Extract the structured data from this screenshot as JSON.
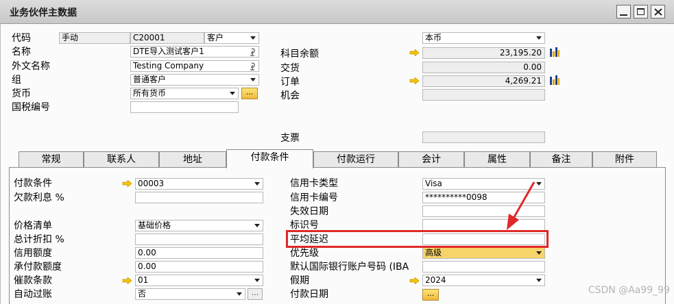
{
  "window": {
    "title": "业务伙伴主数据"
  },
  "header_left": {
    "code_label": "代码",
    "mode": "手动",
    "code_value": "C20001",
    "type_value": "客户",
    "name_label": "名称",
    "name_value": "DTE导入测试客户1",
    "foreign_name_label": "外文名称",
    "foreign_name_value": "Testing Company",
    "group_label": "组",
    "group_value": "普通客户",
    "currency_label": "货币",
    "currency_value": "所有货币",
    "more_glyph": "...",
    "tax_label": "国税编号",
    "tax_value": ""
  },
  "header_right": {
    "currency_select": "本币",
    "balance_label": "科目余额",
    "balance_value": "23,195.20",
    "delivery_label": "交货",
    "delivery_value": "0.00",
    "order_label": "订单",
    "order_value": "4,269.21",
    "opportunity_label": "机会",
    "cheque_label": "支票"
  },
  "tabs": [
    {
      "label": "常规"
    },
    {
      "label": "联系人"
    },
    {
      "label": "地址"
    },
    {
      "label": "付款条件"
    },
    {
      "label": "付款运行"
    },
    {
      "label": "会计"
    },
    {
      "label": "属性"
    },
    {
      "label": "备注"
    },
    {
      "label": "附件"
    }
  ],
  "active_tab": "付款条件",
  "payment": {
    "terms_label": "付款条件",
    "terms_value": "00003",
    "interest_label": "欠款利息 %",
    "price_list_label": "价格清单",
    "price_list_value": "基础价格",
    "discount_label": "总计折扣 %",
    "credit_label": "信用额度",
    "credit_value": "0.00",
    "commitment_label": "承付款额度",
    "commitment_value": "0.00",
    "dunning_label": "催款条款",
    "dunning_value": "01",
    "autopost_label": "自动过账",
    "autopost_value": "否",
    "more_glyph": "..."
  },
  "card": {
    "card_type_label": "信用卡类型",
    "card_type_value": "Visa",
    "card_no_label": "信用卡编号",
    "card_no_value": "**********0098",
    "expiry_label": "失效日期",
    "id_label": "标识号",
    "avg_delay_label": "平均延迟",
    "priority_label": "优先级",
    "priority_value": "高级",
    "iban_label": "默认国际银行账户号码 (IBA",
    "holiday_label": "假期",
    "holiday_value": "2024",
    "pay_date_label": "付款日期",
    "more_glyph": "..."
  },
  "watermark": "CSDN @Aa99_99",
  "colors": {
    "highlight": "#f7d46a",
    "annotation_red": "#e02828",
    "arrow_yellow": "#f5c400"
  }
}
